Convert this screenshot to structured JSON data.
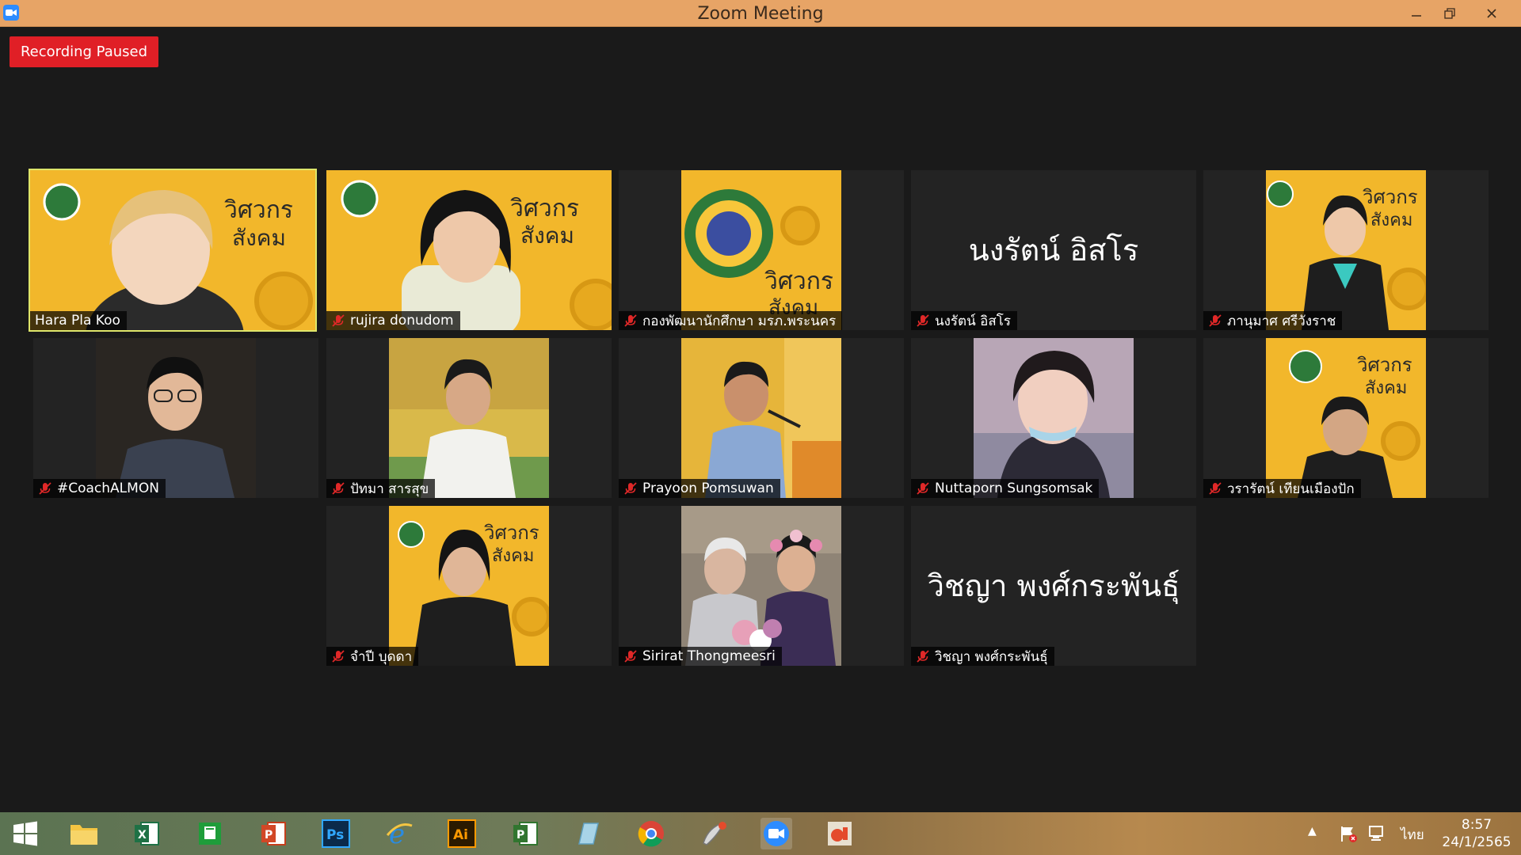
{
  "window": {
    "title": "Zoom Meeting",
    "icon": "zoom-camera-icon"
  },
  "recording": {
    "label": "Recording Paused",
    "color": "#e01f26"
  },
  "active_speaker_color": "#dfe66a",
  "participants": [
    {
      "name": "Hara Pla Koo",
      "muted": false,
      "active": true
    },
    {
      "name": "rujira donudom",
      "muted": true
    },
    {
      "name": "กองพัฒนานักศึกษา มรภ.พระนคร",
      "muted": true
    },
    {
      "name": "นงรัตน์ อิสโร",
      "muted": true,
      "display_text": "นงรัตน์ อิสโร"
    },
    {
      "name": "ภานุมาศ ศรีวังราช",
      "muted": true
    },
    {
      "name": "#CoachALMON",
      "muted": true
    },
    {
      "name": "ปัทมา สารสุข",
      "muted": true
    },
    {
      "name": "Prayoon Pomsuwan",
      "muted": true
    },
    {
      "name": "Nuttaporn Sungsomsak",
      "muted": true
    },
    {
      "name": "วรารัตน์ เทียนเมืองปัก",
      "muted": true
    },
    {
      "name": "จำปี บุดดา",
      "muted": true
    },
    {
      "name": "Sirirat Thongmeesri",
      "muted": true
    },
    {
      "name": "วิชญา พงศ์กระพันธุ์",
      "muted": true,
      "display_text": "วิชญา พงศ์กระพันธุ์"
    }
  ],
  "taskbar": {
    "apps": [
      "windows-start-icon",
      "file-explorer-icon",
      "excel-icon",
      "store-icon",
      "powerpoint-icon",
      "photoshop-icon",
      "internet-explorer-icon",
      "illustrator-icon",
      "project-icon",
      "notes-icon",
      "chrome-icon",
      "paint-icon",
      "zoom-icon",
      "office-icon"
    ],
    "ps_label": "Ps",
    "ai_label": "Ai",
    "language": "ไทย",
    "time": "8:57",
    "date": "24/1/2565"
  }
}
